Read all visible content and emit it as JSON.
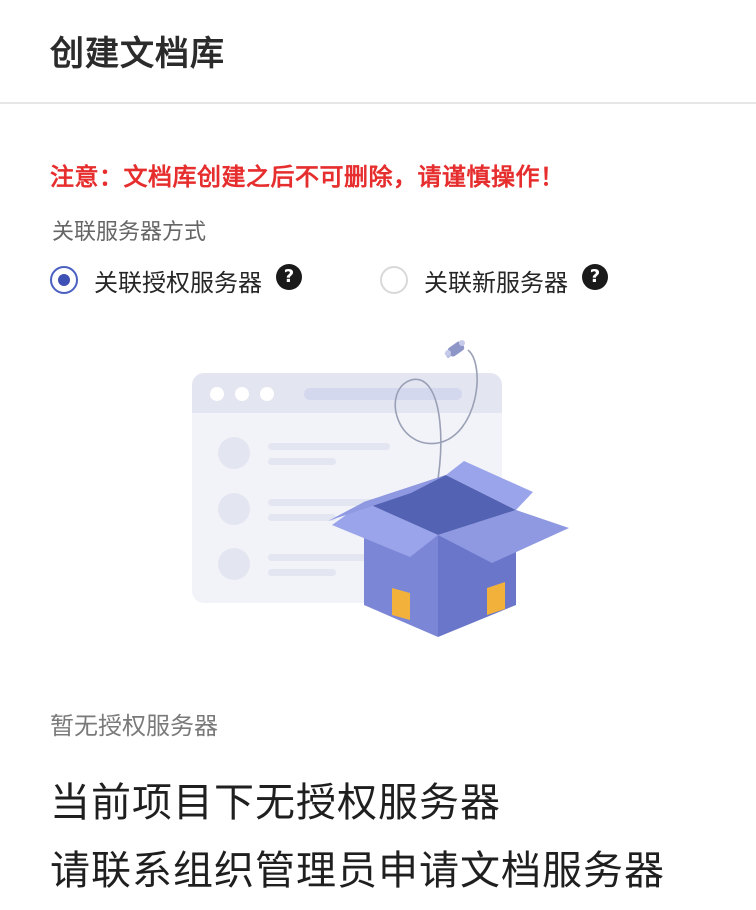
{
  "header": {
    "title": "创建文档库"
  },
  "warning": "注意：文档库创建之后不可删除，请谨慎操作！",
  "association": {
    "label": "关联服务器方式",
    "options": [
      {
        "label": "关联授权服务器",
        "selected": true,
        "help_icon": "question-circle-icon"
      },
      {
        "label": "关联新服务器",
        "selected": false,
        "help_icon": "question-circle-icon"
      }
    ]
  },
  "empty_state": {
    "illustration": "empty-box-illustration",
    "hint": "暂无授权服务器",
    "message_line1": "当前项目下无授权服务器",
    "message_line2": "请联系组织管理员申请文档服务器"
  },
  "colors": {
    "warning": "#e62e2e",
    "accent": "#3f51b5",
    "box": "#7b86d6"
  }
}
